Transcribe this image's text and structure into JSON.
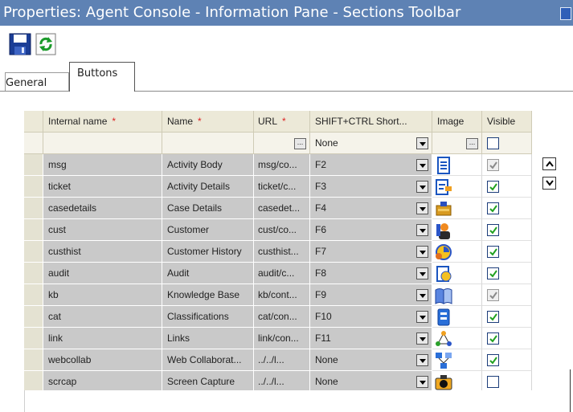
{
  "window": {
    "title": "Properties: Agent Console - Information Pane - Sections Toolbar"
  },
  "toolbar": {
    "save": "save-icon",
    "refresh": "refresh-icon"
  },
  "tabs": [
    {
      "label": "General",
      "active": false
    },
    {
      "label": "Buttons",
      "active": true
    }
  ],
  "grid": {
    "columns": {
      "internal": "Internal name",
      "name": "Name",
      "url": "URL",
      "shortcut": "SHIFT+CTRL Short...",
      "image": "Image",
      "visible": "Visible"
    },
    "required_mark": "*",
    "filter": {
      "shortcut": "None",
      "ellipsis": "..."
    },
    "rows": [
      {
        "internal": "msg",
        "name": "Activity Body",
        "url": "msg/co...",
        "shortcut": "F2",
        "icon": "document-icon",
        "visible": true,
        "disabled": true
      },
      {
        "internal": "ticket",
        "name": "Activity Details",
        "url": "ticket/c...",
        "shortcut": "F3",
        "icon": "details-icon",
        "visible": true,
        "disabled": false
      },
      {
        "internal": "casedetails",
        "name": "Case Details",
        "url": "casedet...",
        "shortcut": "F4",
        "icon": "case-icon",
        "visible": true,
        "disabled": false
      },
      {
        "internal": "cust",
        "name": "Customer",
        "url": "cust/co...",
        "shortcut": "F6",
        "icon": "customer-icon",
        "visible": true,
        "disabled": false
      },
      {
        "internal": "custhist",
        "name": "Customer History",
        "url": "custhist...",
        "shortcut": "F7",
        "icon": "history-icon",
        "visible": true,
        "disabled": false
      },
      {
        "internal": "audit",
        "name": "Audit",
        "url": "audit/c...",
        "shortcut": "F8",
        "icon": "audit-icon",
        "visible": true,
        "disabled": false
      },
      {
        "internal": "kb",
        "name": "Knowledge Base",
        "url": "kb/cont...",
        "shortcut": "F9",
        "icon": "book-icon",
        "visible": true,
        "disabled": true
      },
      {
        "internal": "cat",
        "name": "Classifications",
        "url": "cat/con...",
        "shortcut": "F10",
        "icon": "classification-icon",
        "visible": true,
        "disabled": false
      },
      {
        "internal": "link",
        "name": "Links",
        "url": "link/con...",
        "shortcut": "F11",
        "icon": "links-icon",
        "visible": true,
        "disabled": false
      },
      {
        "internal": "webcollab",
        "name": "Web Collaborat...",
        "url": "../../l...",
        "shortcut": "None",
        "icon": "collab-icon",
        "visible": true,
        "disabled": false
      },
      {
        "internal": "scrcap",
        "name": "Screen Capture",
        "url": "../../l...",
        "shortcut": "None",
        "icon": "camera-icon",
        "visible": false,
        "disabled": false
      }
    ]
  },
  "colors": {
    "title_bar": "#5e82b4",
    "row_gray": "#c9c9c9",
    "header": "#ece9d8",
    "required": "#dd2222",
    "check": "#21a121"
  }
}
